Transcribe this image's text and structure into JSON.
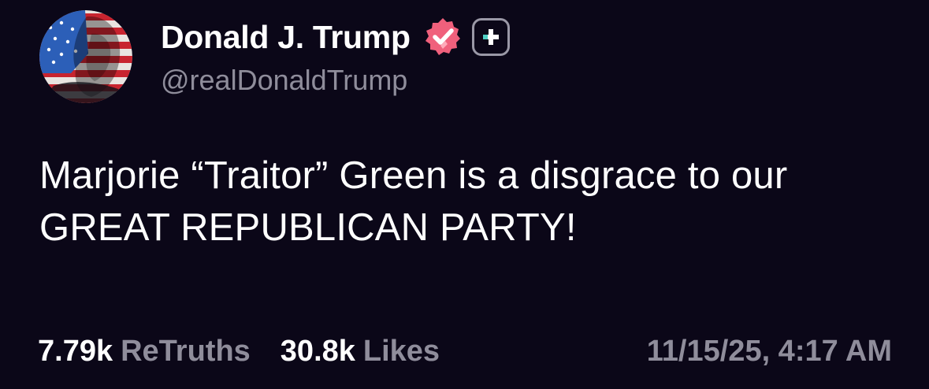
{
  "author": {
    "display_name": "Donald J. Trump",
    "handle": "@realDonaldTrump",
    "avatar_icon": "profile-portrait-flag",
    "verified_icon": "verified-badge-icon",
    "verified_color": "#f0607c",
    "plus_icon": "plus-badge-icon",
    "plus_color": "#4fd1c5"
  },
  "post": {
    "text": "Marjorie “Traitor” Green is a disgrace to our GREAT REPUBLICAN PARTY!"
  },
  "stats": {
    "retruths_count": "7.79k",
    "retruths_label": "ReTruths",
    "likes_count": "30.8k",
    "likes_label": "Likes",
    "timestamp": "11/15/25, 4:17 AM"
  },
  "colors": {
    "background": "#0b0718",
    "primary_text": "#ffffff",
    "secondary_text": "#8f8d9b"
  }
}
